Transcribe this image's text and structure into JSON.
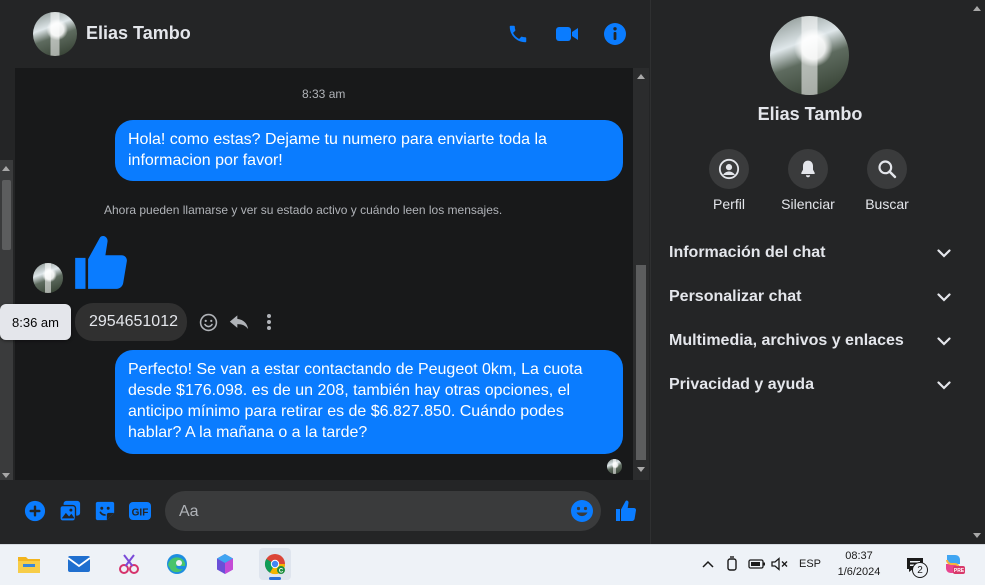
{
  "contact": {
    "name": "Elias Tambo"
  },
  "header": {
    "icons": [
      "phone-icon",
      "video-camera-icon",
      "info-icon"
    ]
  },
  "messages": {
    "timestamp": "8:33 am",
    "outgoing_1": "Hola! como estas? Dejame tu numero para enviarte toda la informacion por favor!",
    "system_note": "Ahora pueden llamarse y ver su estado activo y cuándo leen los mensajes.",
    "incoming_number": "2954651012",
    "incoming_time_tooltip": "8:36 am",
    "outgoing_2": "Perfecto!  Se van a estar contactando de Peugeot 0km, La cuota desde $176.098. es de un 208, también hay otras opciones, el anticipo mínimo para retirar es de $6.827.850. Cuándo podes hablar? A la mañana o a la tarde?"
  },
  "composer": {
    "placeholder": "Aa"
  },
  "info_panel": {
    "name": "Elias Tambo",
    "actions": [
      {
        "label": "Perfil",
        "icon": "profile-icon"
      },
      {
        "label": "Silenciar",
        "icon": "bell-icon"
      },
      {
        "label": "Buscar",
        "icon": "search-icon"
      }
    ],
    "sections": [
      "Información del chat",
      "Personalizar chat",
      "Multimedia, archivos y enlaces",
      "Privacidad y ayuda"
    ]
  },
  "taskbar": {
    "language": "ESP",
    "time": "08:37",
    "date": "1/6/2024",
    "notification_count": "2"
  },
  "colors": {
    "accent": "#0a7cff",
    "background": "#242526",
    "message_area": "#18191a"
  }
}
